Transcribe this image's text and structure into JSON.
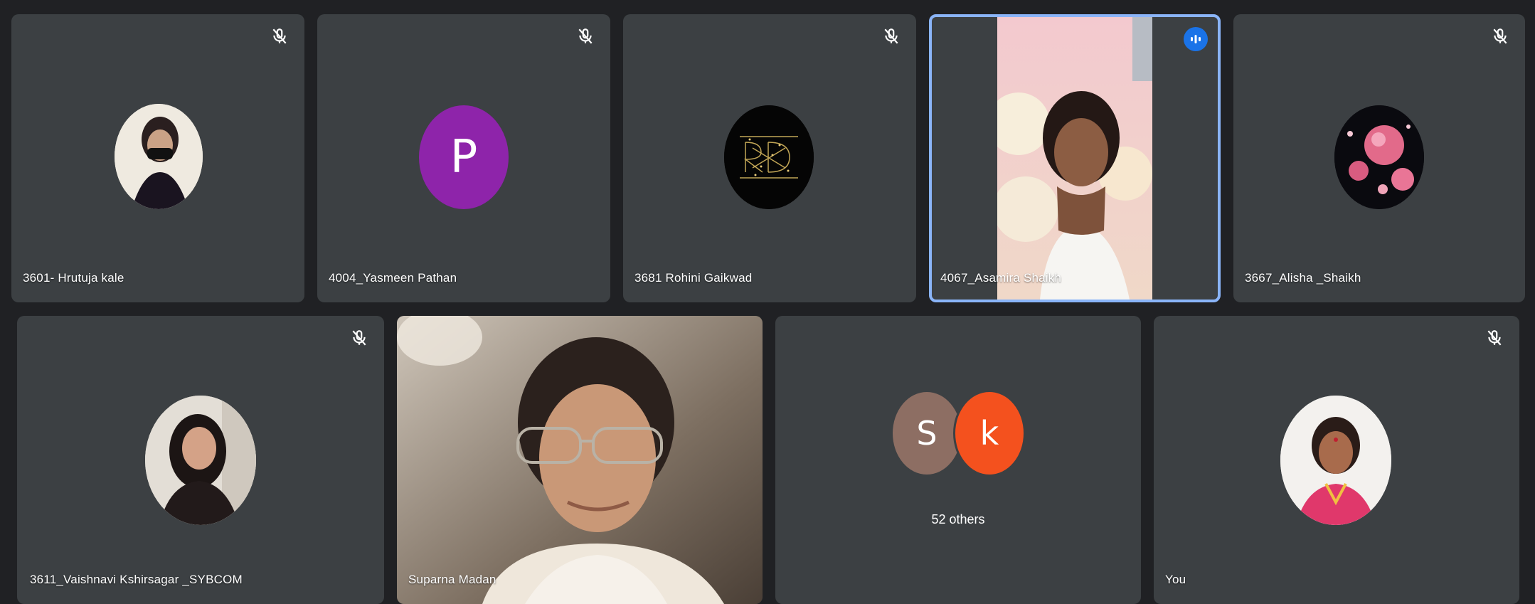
{
  "participants": [
    {
      "name": "3601- Hrutuja kale",
      "muted": true
    },
    {
      "name": "4004_Yasmeen Pathan",
      "muted": true,
      "initial": "P"
    },
    {
      "name": "3681 Rohini Gaikwad",
      "muted": true
    },
    {
      "name": "4067_Asamira Shaikh",
      "muted": false,
      "speaking": true
    },
    {
      "name": "3667_Alisha _Shaikh",
      "muted": true
    },
    {
      "name": "3611_Vaishnavi Kshirsagar _SYBCOM",
      "muted": true
    },
    {
      "name": "Suparna Madan",
      "muted": false
    },
    {
      "name": "You",
      "muted": true
    }
  ],
  "others": {
    "initials": [
      "S",
      "k"
    ],
    "label": "52 others"
  },
  "colors": {
    "background": "#202124",
    "tile": "#3c4043",
    "speaking_outline": "#8ab4f8",
    "purple_avatar": "#8e24aa",
    "s_avatar": "#8d6e63",
    "k_avatar": "#f4511e"
  },
  "icons": {
    "muted": "mic-off-icon",
    "speaking": "audio-wave-icon"
  }
}
